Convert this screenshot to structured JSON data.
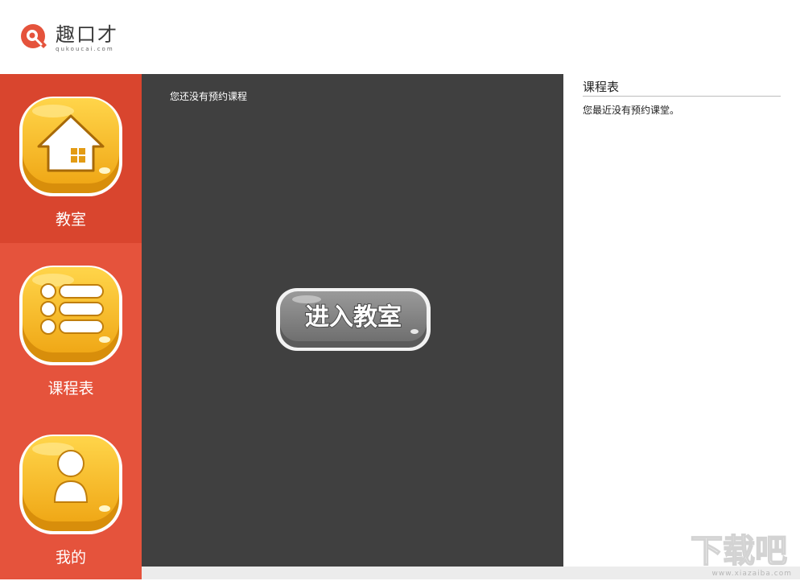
{
  "app": {
    "logo_cn": "趣口才",
    "logo_en": "qukoucai.com"
  },
  "sidebar": {
    "items": [
      {
        "label": "教室",
        "icon": "house-icon",
        "active": true
      },
      {
        "label": "课程表",
        "icon": "list-icon",
        "active": false
      },
      {
        "label": "我的",
        "icon": "user-icon",
        "active": false
      }
    ]
  },
  "main": {
    "message": "您还没有预约课程",
    "enter_button": "进入教室"
  },
  "schedule": {
    "title": "课程表",
    "empty": "您最近没有预约课堂。"
  },
  "watermark": {
    "text": "下载吧",
    "url": "www.xiazaiba.com"
  },
  "colors": {
    "sidebar": "#e5533c",
    "sidebar_active": "#d9452e",
    "main_bg": "#404040",
    "icon_yellow": "#f5b81c"
  }
}
